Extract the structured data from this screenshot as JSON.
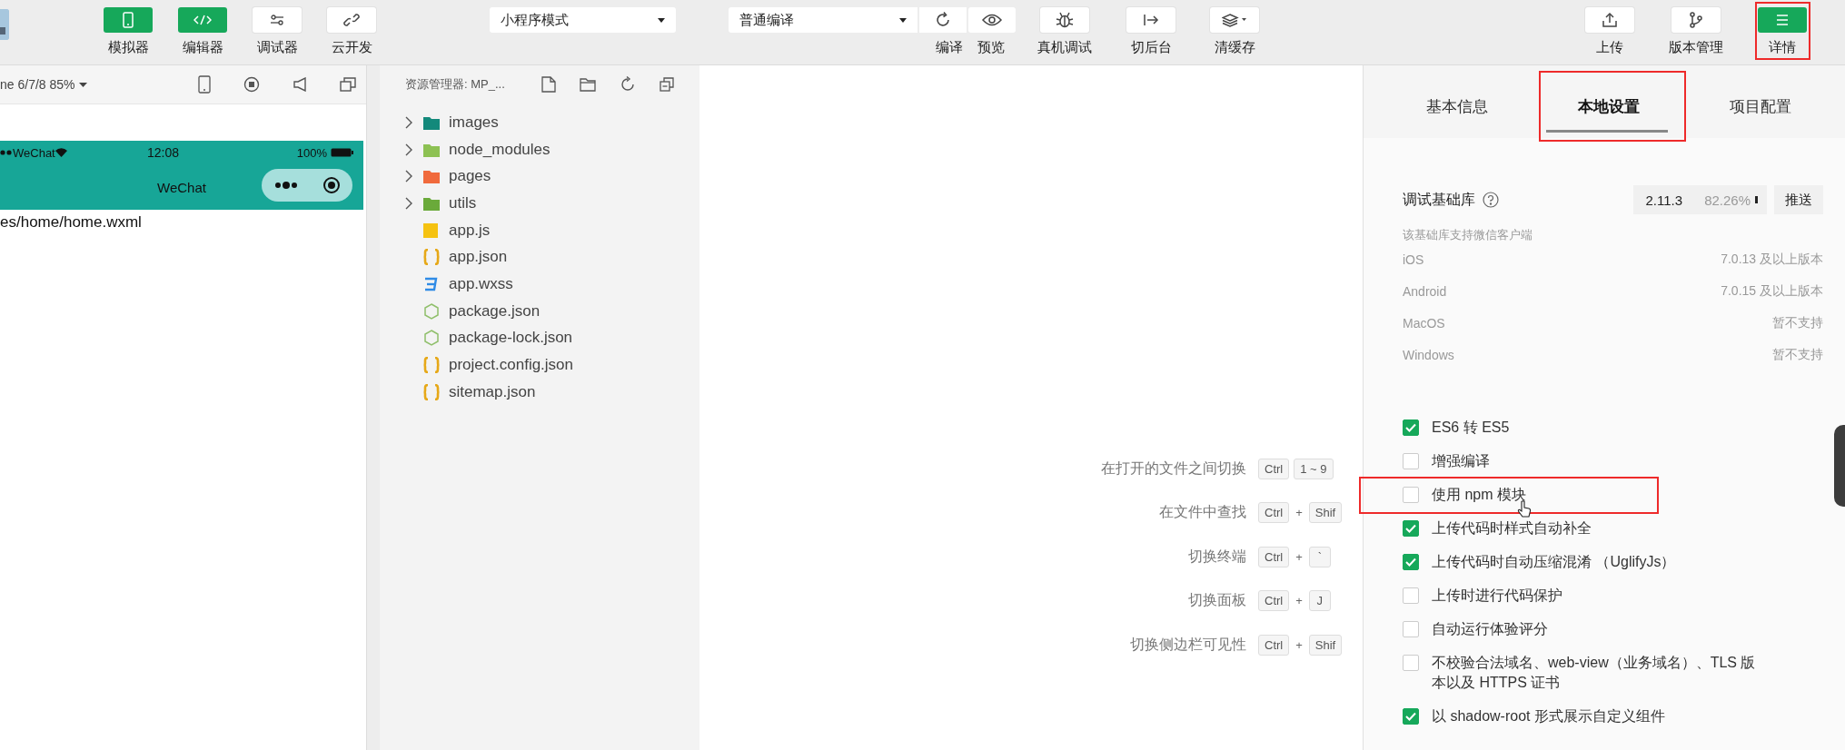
{
  "toolbar": {
    "view_toggles": [
      {
        "kind": "simulator",
        "label": "模拟器",
        "on": true
      },
      {
        "kind": "editor",
        "label": "编辑器",
        "on": true
      },
      {
        "kind": "debugger",
        "label": "调试器",
        "on": false
      },
      {
        "kind": "cloud",
        "label": "云开发",
        "on": false
      }
    ],
    "mode_select": {
      "value": "小程序模式"
    },
    "compile_select": {
      "value": "普通编译"
    },
    "compile_actions": [
      {
        "kind": "compile",
        "label": "编译"
      },
      {
        "kind": "preview",
        "label": "预览"
      }
    ],
    "tools": [
      {
        "kind": "remote-debug",
        "label": "真机调试"
      },
      {
        "kind": "background",
        "label": "切后台"
      },
      {
        "kind": "clear-cache",
        "label": "清缓存"
      }
    ],
    "right_buttons": [
      {
        "kind": "upload",
        "label": "上传",
        "on": false,
        "highlighted": false
      },
      {
        "kind": "version",
        "label": "版本管理",
        "on": false,
        "highlighted": false
      },
      {
        "kind": "details",
        "label": "详情",
        "on": true,
        "highlighted": true
      }
    ]
  },
  "simulator": {
    "device": "ne 6/7/8 85%",
    "status_bar": {
      "carrier": "WeChat",
      "time": "12:08",
      "battery": "100%"
    },
    "nav_title": "WeChat",
    "page_path": "es/home/home.wxml"
  },
  "explorer": {
    "title": "资源管理器: MP_...",
    "items": [
      {
        "kind": "folder",
        "name": "images",
        "color": "#13897b"
      },
      {
        "kind": "folder",
        "name": "node_modules",
        "color": "#8dc153"
      },
      {
        "kind": "folder",
        "name": "pages",
        "color": "#f06a3c"
      },
      {
        "kind": "folder",
        "name": "utils",
        "color": "#6aaa3a"
      },
      {
        "kind": "js",
        "name": "app.js",
        "color": "#f5c211"
      },
      {
        "kind": "json",
        "name": "app.json",
        "color": "#e6a817"
      },
      {
        "kind": "css",
        "name": "app.wxss",
        "color": "#2f8be6"
      },
      {
        "kind": "node",
        "name": "package.json",
        "color": "#8fbf6a"
      },
      {
        "kind": "node",
        "name": "package-lock.json",
        "color": "#8fbf6a"
      },
      {
        "kind": "json",
        "name": "project.config.json",
        "color": "#e6a817"
      },
      {
        "kind": "json",
        "name": "sitemap.json",
        "color": "#e6a817"
      }
    ]
  },
  "shortcuts": [
    {
      "label": "在打开的文件之间切换",
      "keys": [
        {
          "kind": "key",
          "text": "Ctrl"
        },
        {
          "kind": "key",
          "text": "1 ~ 9"
        }
      ]
    },
    {
      "label": "在文件中查找",
      "keys": [
        {
          "kind": "key",
          "text": "Ctrl"
        },
        {
          "kind": "plus",
          "text": "+"
        },
        {
          "kind": "key",
          "text": "Shif"
        }
      ]
    },
    {
      "label": "切换终端",
      "keys": [
        {
          "kind": "key",
          "text": "Ctrl"
        },
        {
          "kind": "plus",
          "text": "+"
        },
        {
          "kind": "key",
          "text": "`"
        }
      ]
    },
    {
      "label": "切换面板",
      "keys": [
        {
          "kind": "key",
          "text": "Ctrl"
        },
        {
          "kind": "plus",
          "text": "+"
        },
        {
          "kind": "key",
          "text": "J"
        }
      ]
    },
    {
      "label": "切换侧边栏可见性",
      "keys": [
        {
          "kind": "key",
          "text": "Ctrl"
        },
        {
          "kind": "plus",
          "text": "+"
        },
        {
          "kind": "key",
          "text": "Shif"
        }
      ]
    }
  ],
  "details": {
    "tabs": [
      {
        "label": "基本信息",
        "selected": false,
        "highlighted": false
      },
      {
        "label": "本地设置",
        "selected": true,
        "highlighted": true
      },
      {
        "label": "项目配置",
        "selected": false,
        "highlighted": false
      }
    ],
    "base_library": {
      "label": "调试基础库",
      "version": "2.11.3",
      "share": "82.26%",
      "push_button": "推送"
    },
    "support_note": "该基础库支持微信客户端",
    "platforms": [
      {
        "name": "iOS",
        "support": "7.0.13 及以上版本"
      },
      {
        "name": "Android",
        "support": "7.0.15 及以上版本"
      },
      {
        "name": "MacOS",
        "support": "暂不支持"
      },
      {
        "name": "Windows",
        "support": "暂不支持"
      }
    ],
    "options": [
      {
        "label": "ES6 转 ES5",
        "checked": true,
        "highlighted": false,
        "hovered": false
      },
      {
        "label": "增强编译",
        "checked": false,
        "highlighted": false,
        "hovered": false
      },
      {
        "label": "使用 npm 模块",
        "checked": false,
        "highlighted": true,
        "hovered": true
      },
      {
        "label": "上传代码时样式自动补全",
        "checked": true,
        "highlighted": false,
        "hovered": false
      },
      {
        "label": "上传代码时自动压缩混淆 （UglifyJs）",
        "checked": true,
        "highlighted": false,
        "hovered": false
      },
      {
        "label": "上传时进行代码保护",
        "checked": false,
        "highlighted": false,
        "hovered": false
      },
      {
        "label": "自动运行体验评分",
        "checked": false,
        "highlighted": false,
        "hovered": false
      },
      {
        "label": "不校验合法域名、web-view（业务域名）、TLS 版本以及 HTTPS 证书",
        "checked": false,
        "highlighted": false,
        "hovered": false
      },
      {
        "label": "以 shadow-root 形式展示自定义组件",
        "checked": true,
        "highlighted": false,
        "hovered": false
      }
    ]
  }
}
